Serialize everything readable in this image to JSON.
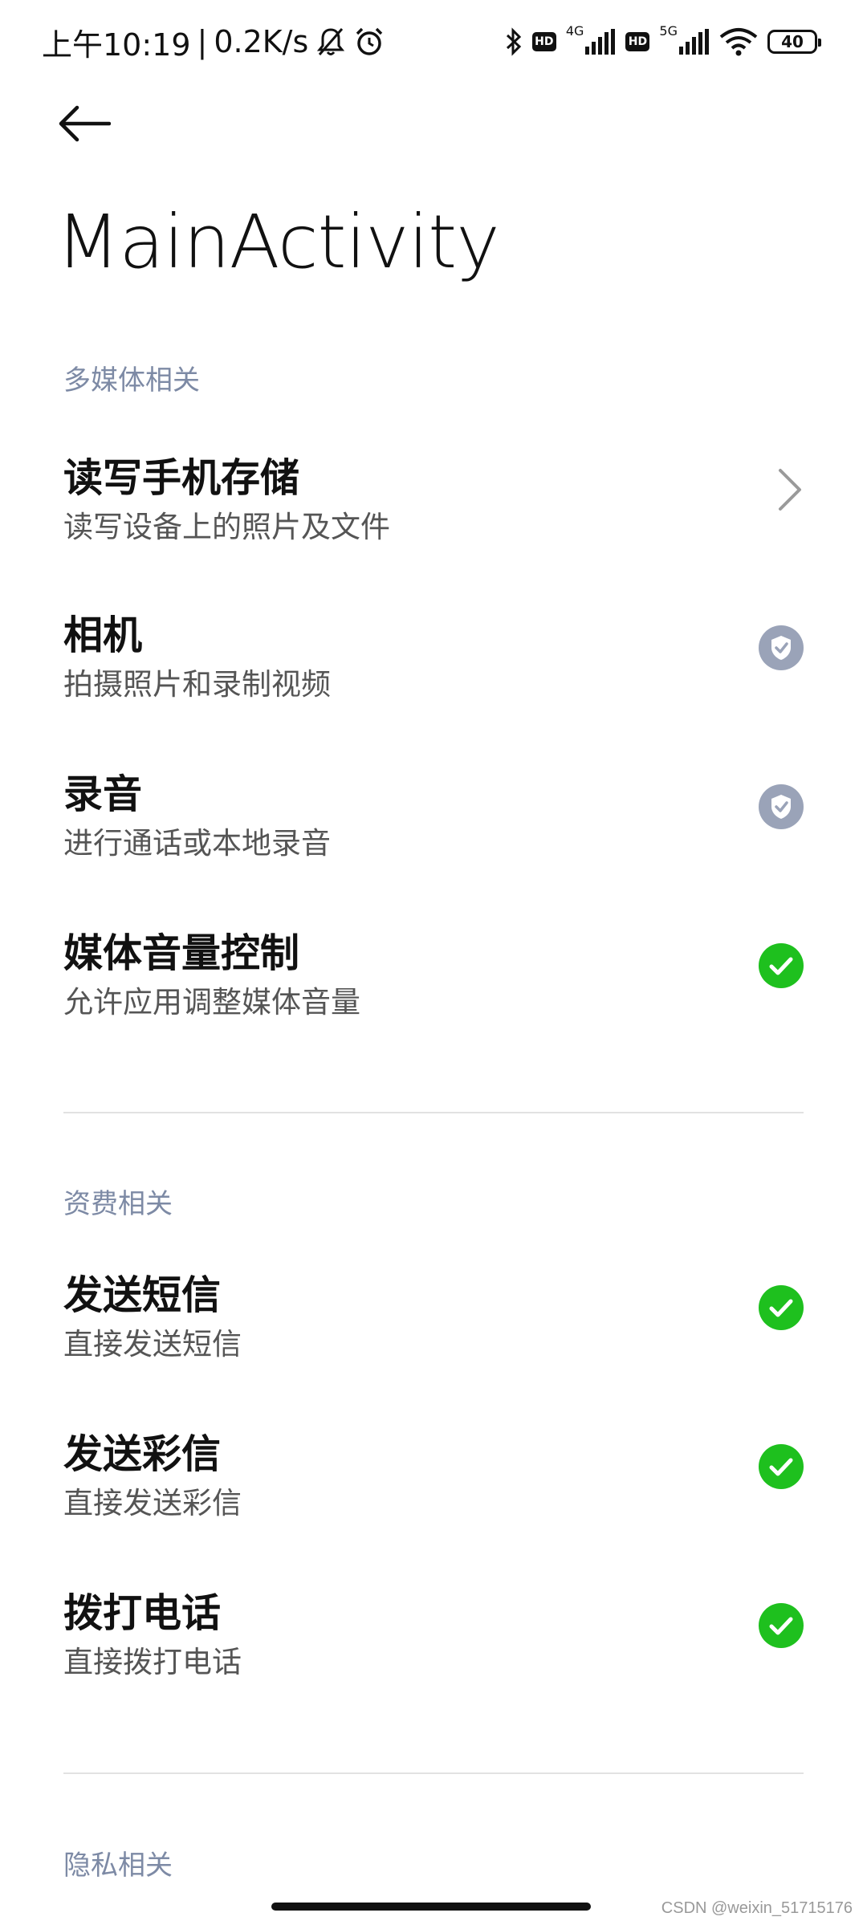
{
  "status_bar": {
    "time": "上午10:19",
    "separator": "|",
    "net_speed": "0.2K/s",
    "net_4g": "4G",
    "net_5g": "5G",
    "hd_label": "HD",
    "battery": "40"
  },
  "header": {
    "title": "MainActivity"
  },
  "sections": [
    {
      "header": "多媒体相关",
      "items": [
        {
          "title": "读写手机存储",
          "desc": "读写设备上的照片及文件",
          "status": "chevron"
        },
        {
          "title": "相机",
          "desc": "拍摄照片和录制视频",
          "status": "shield"
        },
        {
          "title": "录音",
          "desc": "进行通话或本地录音",
          "status": "shield"
        },
        {
          "title": "媒体音量控制",
          "desc": "允许应用调整媒体音量",
          "status": "granted"
        }
      ]
    },
    {
      "header": "资费相关",
      "items": [
        {
          "title": "发送短信",
          "desc": "直接发送短信",
          "status": "granted"
        },
        {
          "title": "发送彩信",
          "desc": "直接发送彩信",
          "status": "granted"
        },
        {
          "title": "拨打电话",
          "desc": "直接拨打电话",
          "status": "granted"
        }
      ]
    },
    {
      "header": "隐私相关",
      "items": []
    }
  ],
  "colors": {
    "granted": "#1ec01e",
    "shield": "#9aa3b8",
    "section_header": "#7d8aa5"
  },
  "watermark": "CSDN @weixin_51715176"
}
